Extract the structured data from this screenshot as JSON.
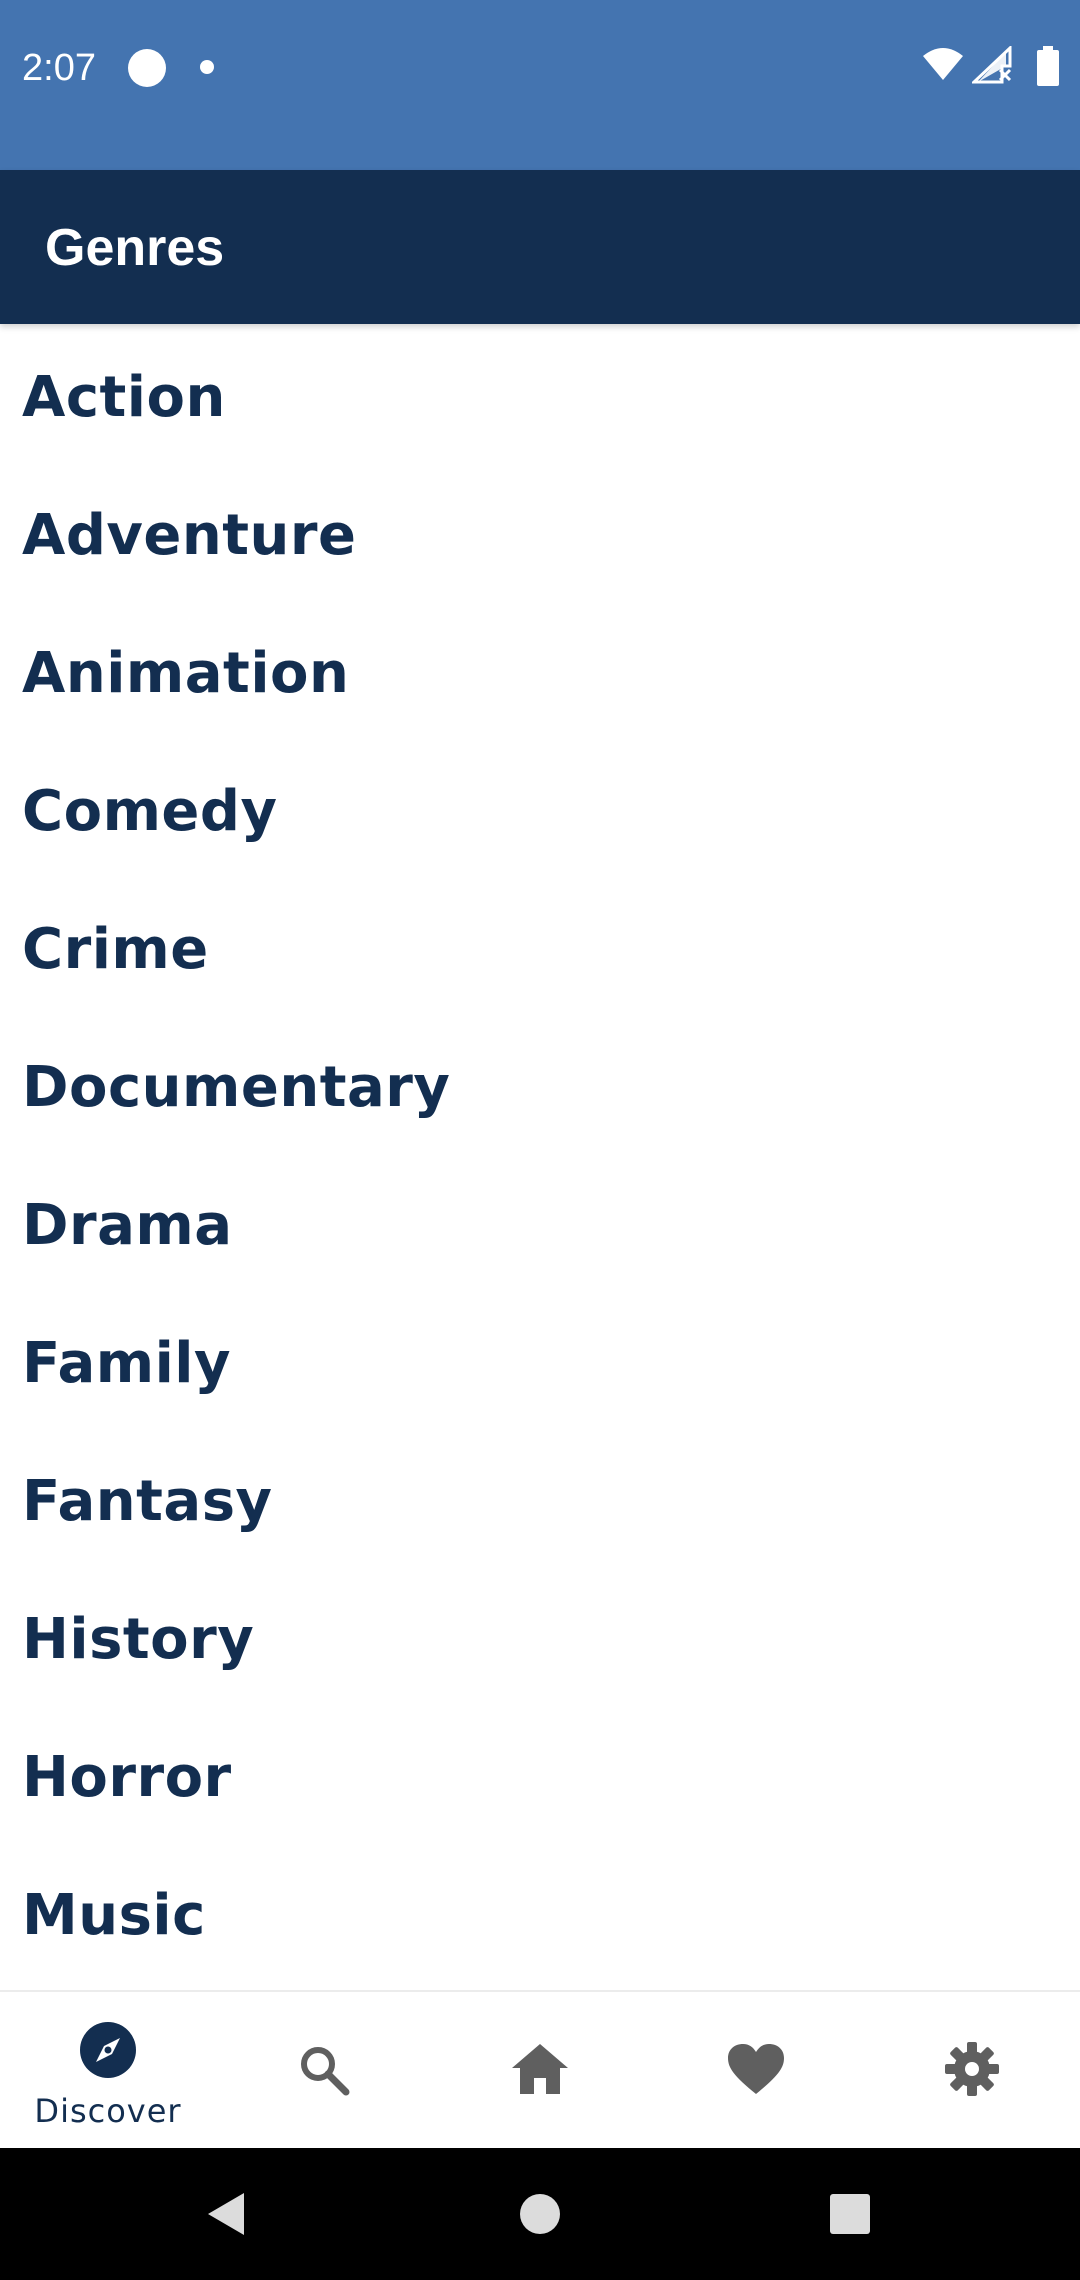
{
  "status_bar": {
    "time": "2:07",
    "background": "#4474b0",
    "icons": [
      "notification-dot-icon",
      "small-dot-icon",
      "wifi-icon",
      "cellular-no-service-icon",
      "battery-icon"
    ]
  },
  "app_bar": {
    "title": "Genres",
    "background": "#132e50"
  },
  "genres": [
    "Action",
    "Adventure",
    "Animation",
    "Comedy",
    "Crime",
    "Documentary",
    "Drama",
    "Family",
    "Fantasy",
    "History",
    "Horror",
    "Music"
  ],
  "bottom_nav": {
    "items": [
      {
        "icon": "compass-icon",
        "label": "Discover",
        "selected": true
      },
      {
        "icon": "search-icon",
        "label": "",
        "selected": false
      },
      {
        "icon": "home-icon",
        "label": "",
        "selected": false
      },
      {
        "icon": "heart-icon",
        "label": "",
        "selected": false
      },
      {
        "icon": "gear-icon",
        "label": "",
        "selected": false
      }
    ],
    "active_color": "#132e50",
    "inactive_color": "#5f5f5f"
  },
  "system_nav": {
    "buttons": [
      "back-icon",
      "home-circle-icon",
      "recents-icon"
    ]
  }
}
